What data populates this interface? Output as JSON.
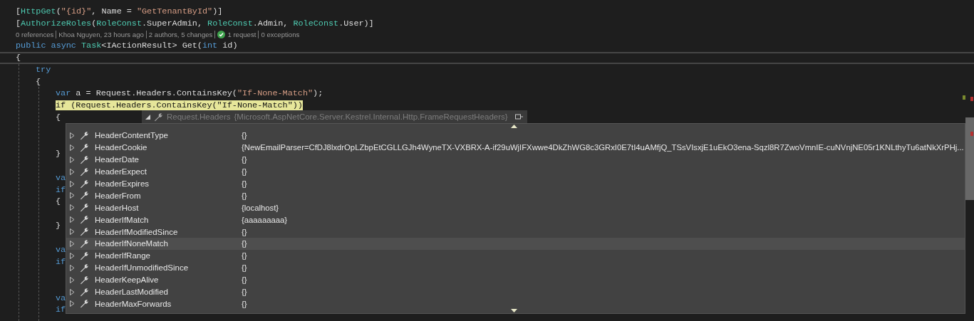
{
  "code_lines": [
    {
      "kind": "code",
      "tokens": [
        {
          "kind": "plain",
          "text": "["
        },
        {
          "kind": "type",
          "text": "HttpGet"
        },
        {
          "kind": "plain",
          "text": "("
        },
        {
          "kind": "string",
          "text": "\"{id}\""
        },
        {
          "kind": "plain",
          "text": ", Name = "
        },
        {
          "kind": "string",
          "text": "\"GetTenantById\""
        },
        {
          "kind": "plain",
          "text": ")]"
        }
      ]
    },
    {
      "kind": "code",
      "tokens": [
        {
          "kind": "plain",
          "text": "["
        },
        {
          "kind": "type",
          "text": "AuthorizeRoles"
        },
        {
          "kind": "plain",
          "text": "("
        },
        {
          "kind": "type",
          "text": "RoleConst"
        },
        {
          "kind": "plain",
          "text": ".SuperAdmin, "
        },
        {
          "kind": "type",
          "text": "RoleConst"
        },
        {
          "kind": "plain",
          "text": ".Admin, "
        },
        {
          "kind": "type",
          "text": "RoleConst"
        },
        {
          "kind": "plain",
          "text": ".User)]"
        }
      ]
    },
    {
      "kind": "codelens",
      "items": [
        {
          "text": "0 references"
        },
        {
          "text": "Khoa Nguyen, 23 hours ago"
        },
        {
          "text": "2 authors, 5 changes"
        },
        {
          "text": "1 request",
          "check": true
        },
        {
          "text": "0 exceptions"
        }
      ]
    },
    {
      "kind": "code",
      "tokens": [
        {
          "kind": "keyword",
          "text": "public async "
        },
        {
          "kind": "type",
          "text": "Task"
        },
        {
          "kind": "plain",
          "text": "<IActionResult> Get("
        },
        {
          "kind": "keyword",
          "text": "int"
        },
        {
          "kind": "plain",
          "text": " id)"
        }
      ]
    },
    {
      "kind": "code",
      "current": true,
      "tokens": [
        {
          "kind": "plain",
          "text": "{"
        }
      ],
      "children": [
        {
          "kind": "code",
          "tokens": [
            {
              "kind": "keyword",
              "text": "try"
            }
          ]
        },
        {
          "kind": "code",
          "tokens": [
            {
              "kind": "plain",
              "text": "{"
            }
          ],
          "children": [
            {
              "kind": "code",
              "tokens": [
                {
                  "kind": "keyword",
                  "text": "var"
                },
                {
                  "kind": "plain",
                  "text": " a = Request.Headers.ContainsKey("
                },
                {
                  "kind": "string",
                  "text": "\"If-None-Match\""
                },
                {
                  "kind": "plain",
                  "text": ");"
                }
              ]
            },
            {
              "kind": "code",
              "highlighted": true,
              "tokens": [
                {
                  "kind": "keyword",
                  "text": "if"
                },
                {
                  "kind": "plain",
                  "text": " (Request.Headers.ContainsKey("
                },
                {
                  "kind": "string",
                  "text": "\"If-None-Match\""
                },
                {
                  "kind": "plain",
                  "text": "))"
                }
              ]
            },
            {
              "kind": "code",
              "tokens": [
                {
                  "kind": "plain",
                  "text": "{"
                }
              ]
            },
            {
              "kind": "blank"
            },
            {
              "kind": "blank"
            },
            {
              "kind": "code",
              "tokens": [
                {
                  "kind": "plain",
                  "text": "}"
                }
              ]
            },
            {
              "kind": "blank"
            },
            {
              "kind": "code",
              "tokens": [
                {
                  "kind": "keyword",
                  "text": "va"
                }
              ]
            },
            {
              "kind": "code",
              "tokens": [
                {
                  "kind": "keyword",
                  "text": "if"
                }
              ]
            },
            {
              "kind": "code",
              "tokens": [
                {
                  "kind": "plain",
                  "text": "{"
                }
              ]
            },
            {
              "kind": "blank"
            },
            {
              "kind": "code",
              "tokens": [
                {
                  "kind": "plain",
                  "text": "}"
                }
              ]
            },
            {
              "kind": "blank"
            },
            {
              "kind": "code",
              "tokens": [
                {
                  "kind": "keyword",
                  "text": "va"
                }
              ]
            },
            {
              "kind": "code",
              "tokens": [
                {
                  "kind": "keyword",
                  "text": "if"
                }
              ]
            },
            {
              "kind": "blank"
            },
            {
              "kind": "blank"
            },
            {
              "kind": "code",
              "tokens": [
                {
                  "kind": "keyword",
                  "text": "va"
                }
              ]
            },
            {
              "kind": "code",
              "tokens": [
                {
                  "kind": "keyword",
                  "text": "if"
                }
              ]
            }
          ]
        }
      ]
    }
  ],
  "datatip": {
    "expression": "Request.Headers",
    "type": "{Microsoft.AspNetCore.Server.Kestrel.Internal.Http.FrameRequestHeaders}",
    "rows": [
      {
        "name": "HeaderContentType",
        "value": "{}",
        "selected": false
      },
      {
        "name": "HeaderCookie",
        "value": "{NewEmailParser=CfDJ8lxdrOpLZbpEtCGLLGJh4WyneTX-VXBRX-A-if29uWjIFXwwe4DkZhWG8c3GRxI0E7tI4uAMfjQ_TSsVIsxjE1uEkO3ena-Sqzl8R7ZwoVmnIE-cuNVnjNE05r1KNLthyTu6atNkXrPHj...",
        "selected": false
      },
      {
        "name": "HeaderDate",
        "value": "{}",
        "selected": false
      },
      {
        "name": "HeaderExpect",
        "value": "{}",
        "selected": false
      },
      {
        "name": "HeaderExpires",
        "value": "{}",
        "selected": false
      },
      {
        "name": "HeaderFrom",
        "value": "{}",
        "selected": false
      },
      {
        "name": "HeaderHost",
        "value": "{localhost}",
        "selected": false
      },
      {
        "name": "HeaderIfMatch",
        "value": "{aaaaaaaaa}",
        "selected": false
      },
      {
        "name": "HeaderIfModifiedSince",
        "value": "{}",
        "selected": false
      },
      {
        "name": "HeaderIfNoneMatch",
        "value": "{}",
        "selected": true
      },
      {
        "name": "HeaderIfRange",
        "value": "{}",
        "selected": false
      },
      {
        "name": "HeaderIfUnmodifiedSince",
        "value": "{}",
        "selected": false
      },
      {
        "name": "HeaderKeepAlive",
        "value": "{}",
        "selected": false
      },
      {
        "name": "HeaderLastModified",
        "value": "{}",
        "selected": false
      },
      {
        "name": "HeaderMaxForwards",
        "value": "{}",
        "selected": false
      }
    ]
  }
}
